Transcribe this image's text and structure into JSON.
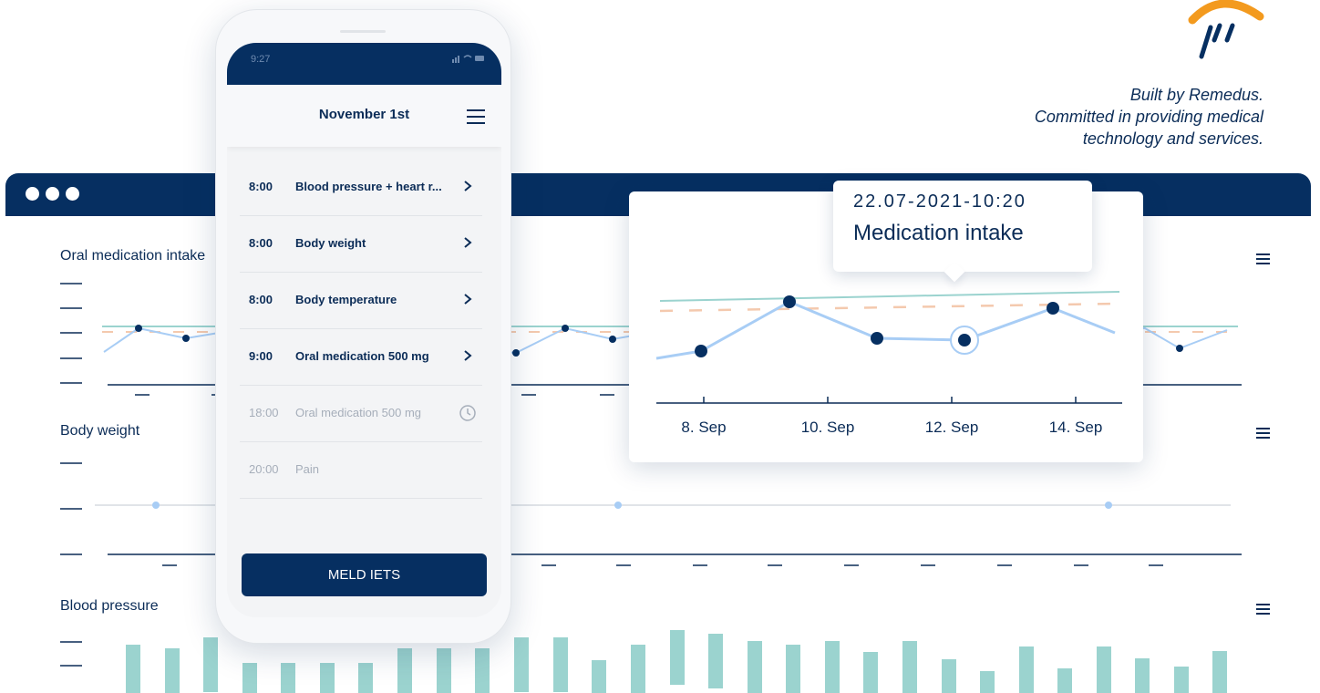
{
  "brand": {
    "logo": "remedus-logo",
    "tagline": [
      "Built by Remedus.",
      "Committed in providing medical",
      "technology and services."
    ]
  },
  "colors": {
    "navy": "#062f61",
    "accent": "#f39a1e",
    "line": "#a8cdf5",
    "teal": "#9bd3cf",
    "target": "#f4c9ae"
  },
  "dashboard": {
    "charts": [
      {
        "label": "Oral medication intake",
        "menu_icon": "hamburger-icon"
      },
      {
        "label": "Body weight",
        "menu_icon": "hamburger-icon"
      },
      {
        "label": "Blood pressure",
        "menu_icon": "hamburger-icon"
      }
    ]
  },
  "phone": {
    "status_time": "9:27",
    "status_icons": "signal-wifi-battery-icons",
    "title": "November 1st",
    "tasks": [
      {
        "time": "8:00",
        "name": "Blood pressure + heart r...",
        "status": "active",
        "icon": "chevron-right-icon"
      },
      {
        "time": "8:00",
        "name": "Body weight",
        "status": "active",
        "icon": "chevron-right-icon"
      },
      {
        "time": "8:00",
        "name": "Body temperature",
        "status": "active",
        "icon": "chevron-right-icon"
      },
      {
        "time": "9:00",
        "name": "Oral medication 500 mg",
        "status": "active",
        "icon": "chevron-right-icon"
      },
      {
        "time": "18:00",
        "name": "Oral medication 500 mg",
        "status": "pending",
        "icon": "clock-icon"
      },
      {
        "time": "20:00",
        "name": "Pain",
        "status": "pending",
        "icon": ""
      }
    ],
    "button": "MELD IETS"
  },
  "popup": {
    "tooltip_date": "22.07-2021-10:20",
    "tooltip_title": "Medication intake"
  },
  "chart_data": {
    "type": "line",
    "x_tick_labels": [
      "8. Sep",
      "10. Sep",
      "12. Sep",
      "14. Sep"
    ],
    "highlighted_point_index": 4
  }
}
